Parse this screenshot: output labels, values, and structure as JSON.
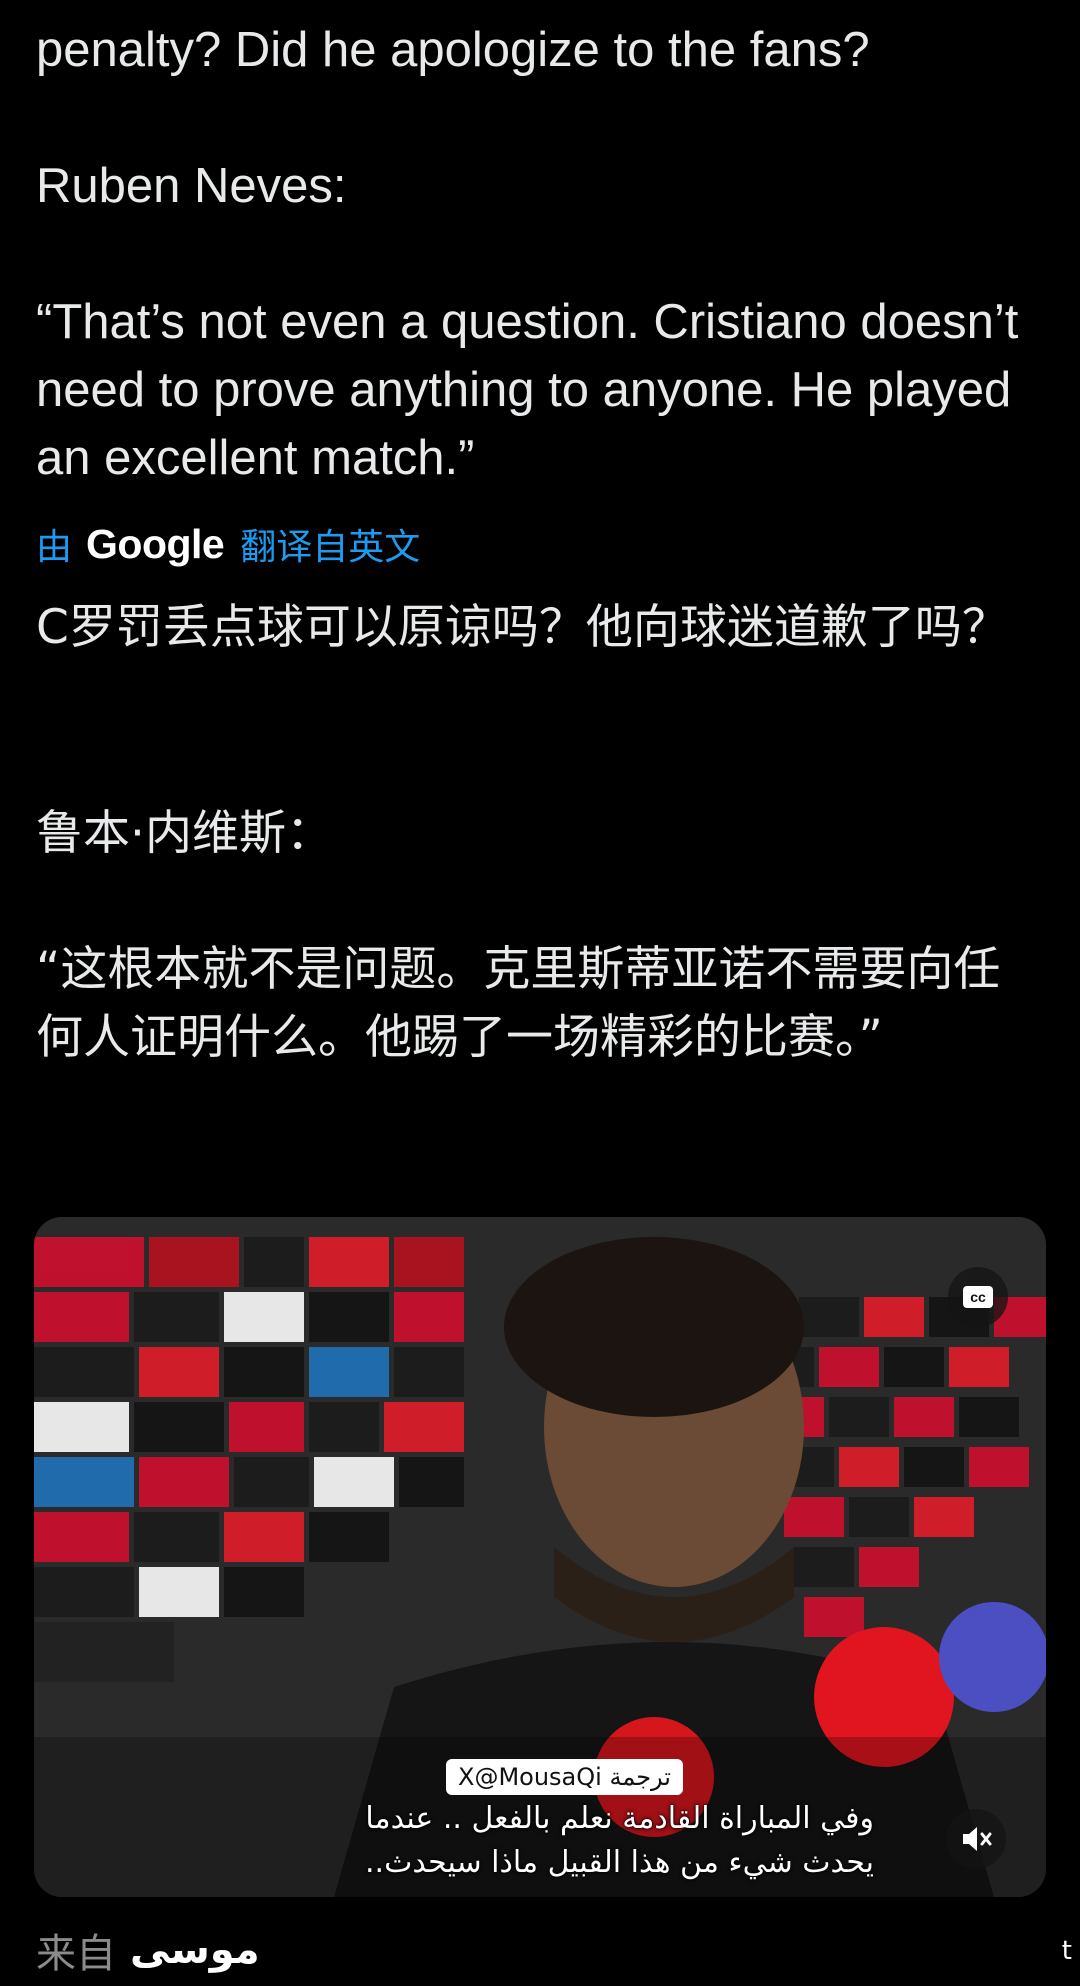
{
  "tweet": {
    "original_lines": {
      "question_tail": "penalty? Did he apologize to the fans?",
      "speaker": "Ruben Neves:",
      "quote": "“That’s not even a question. Cristiano doesn’t need to prove anything to anyone. He played an excellent match.”"
    },
    "translation_bar": {
      "by": "由",
      "provider": "Google",
      "from_label": "翻译自英文"
    },
    "translated_lines": {
      "question": "C罗罚丢点球可以原谅吗？他向球迷道歉了吗？",
      "speaker": "鲁本·内维斯：",
      "quote": "“这根本就不是问题。克里斯蒂亚诺不需要向任何人证明什么。他踢了一场精彩的比赛。”"
    },
    "video": {
      "cc_label": "cc",
      "watermark": "X@MousaQi ترجمة",
      "subtitle_line1": "وفي المباراة القادمة نعلم بالفعل .. عندما",
      "subtitle_line2": "يحدث شيء من هذا القبيل ماذا سيحدث..",
      "mute_icon": "speaker-muted-icon"
    },
    "source": {
      "prefix": "来自",
      "name": "موسى"
    },
    "corner_mark": "t"
  },
  "colors": {
    "background": "#000000",
    "text": "#e7e9ea",
    "link_blue": "#1d9bf0",
    "muted_gray": "#8b8b8b"
  }
}
